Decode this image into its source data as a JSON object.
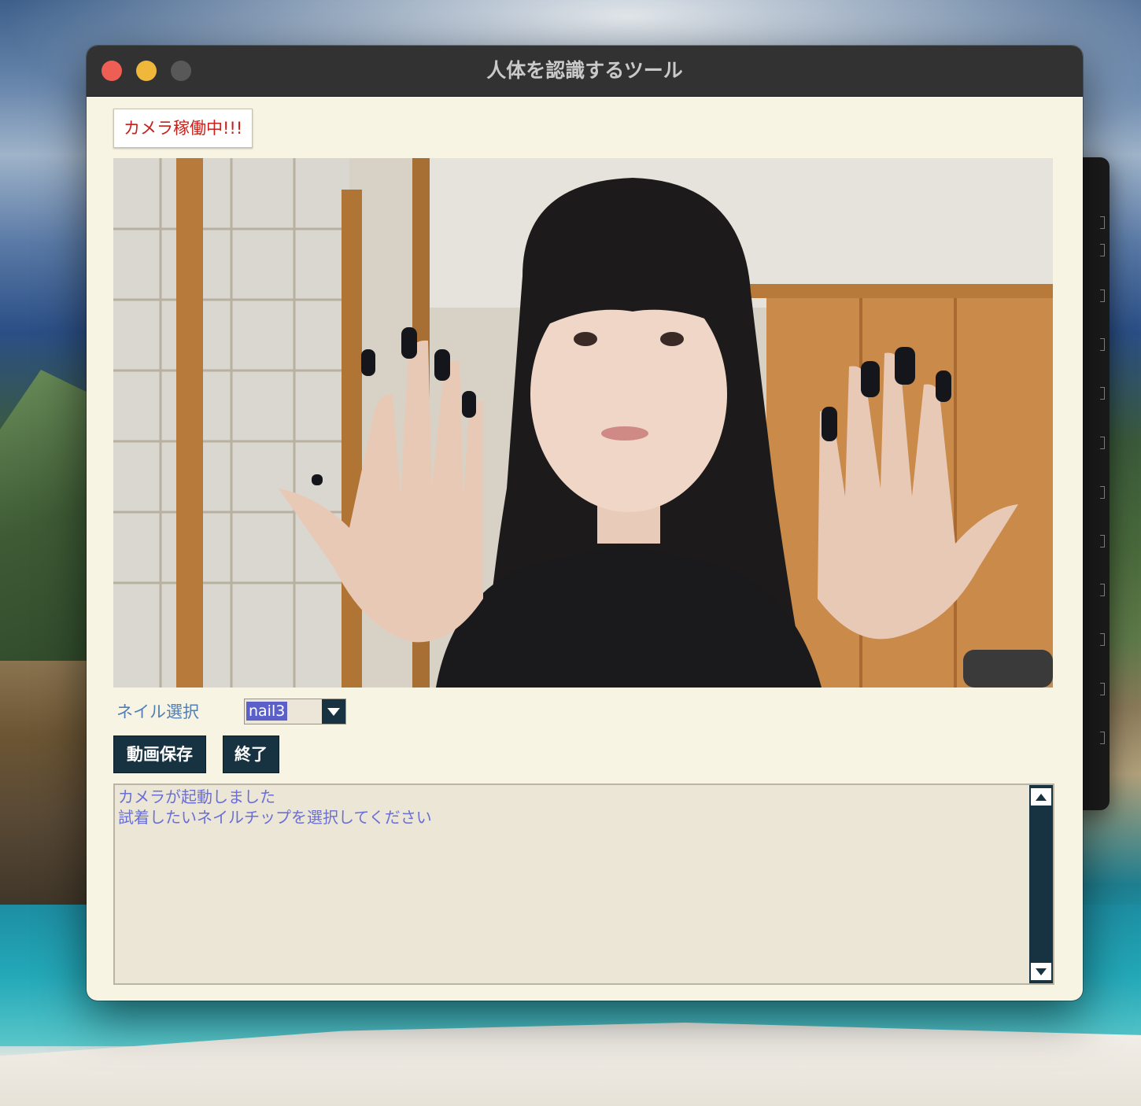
{
  "window": {
    "title": "人体を認識するツール"
  },
  "status": {
    "text": "カメラ稼働中!!!"
  },
  "nail_selector": {
    "label": "ネイル選択",
    "selected": "nail3"
  },
  "buttons": {
    "save_video": "動画保存",
    "quit": "終了"
  },
  "log": {
    "lines": "カメラが起動しました\n試着したいネイルチップを選択してください"
  },
  "colors": {
    "window_bg": "#f8f4e4",
    "titlebar": "#323232",
    "status_text": "#c8201a",
    "label_text": "#4f7fb6",
    "button_bg": "#173341",
    "log_text": "#6a6fd6",
    "selection_bg": "#5a5fc9"
  },
  "icons": {
    "close": "close-traffic-light",
    "minimize": "minimize-traffic-light",
    "maximize": "maximize-traffic-light",
    "dropdown": "chevron-down-icon",
    "scroll_up": "scroll-up-arrow-icon",
    "scroll_down": "scroll-down-arrow-icon"
  }
}
